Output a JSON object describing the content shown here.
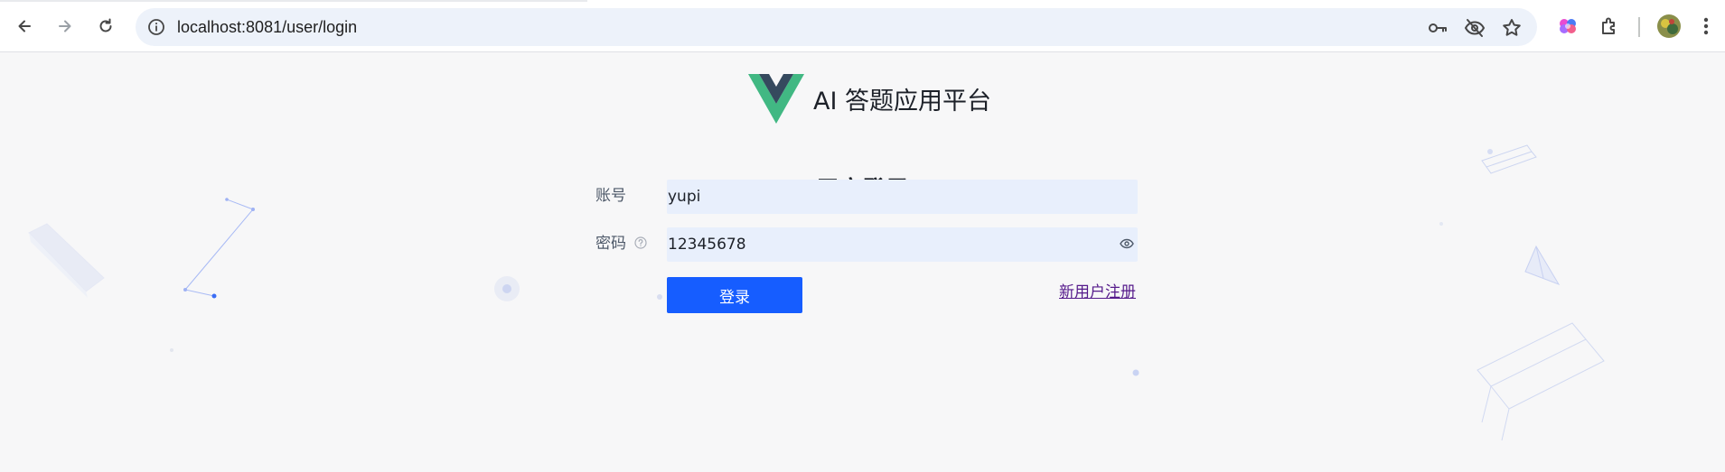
{
  "browser": {
    "url": "localhost:8081/user/login"
  },
  "app": {
    "brand_name": "AI 答题应用平台",
    "accent_color": "#165dff"
  },
  "login_form": {
    "title": "用户登录",
    "account_label": "账号",
    "account_value": "yupi",
    "password_label": "密码",
    "password_value": "12345678",
    "submit_label": "登录",
    "register_link": "新用户注册"
  }
}
